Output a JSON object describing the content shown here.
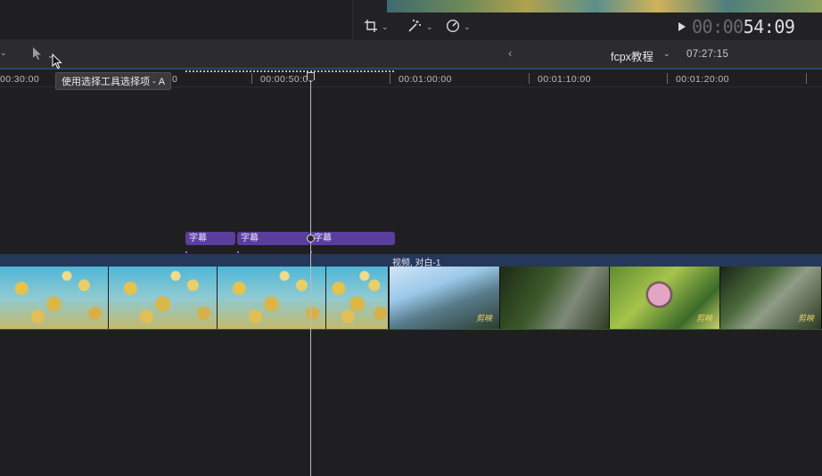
{
  "viewer": {
    "tools": {
      "transform_icon": "crop-transform-icon",
      "enhance_icon": "magic-wand-icon",
      "speed_icon": "retime-speedometer-icon",
      "chevron": "⌄"
    },
    "timecode_dim": "00:00",
    "timecode_bright": "54:09"
  },
  "toolbar": {
    "select_tool_icon": "arrow-pointer-icon",
    "nav_back_icon": "chevron-left-icon",
    "project_name": "fcpx教程",
    "duration": "07:27:15"
  },
  "tooltip": "使用选择工具选择项 - A",
  "ruler": {
    "labels": [
      "00:30:00",
      "0",
      "00:00:50:00",
      "00:01:00:00",
      "00:01:10:00",
      "00:01:20:00"
    ]
  },
  "titles": [
    {
      "label": "字幕"
    },
    {
      "label": "字幕"
    },
    {
      "label": "字幕"
    }
  ],
  "video": {
    "clip2_label": "视频, 对白-1",
    "watermark": "剪映"
  },
  "colors": {
    "background": "#1f1f21",
    "title_clip": "#5a3e9c",
    "video_role": "#25375a",
    "accent_blue": "#2c4672"
  }
}
